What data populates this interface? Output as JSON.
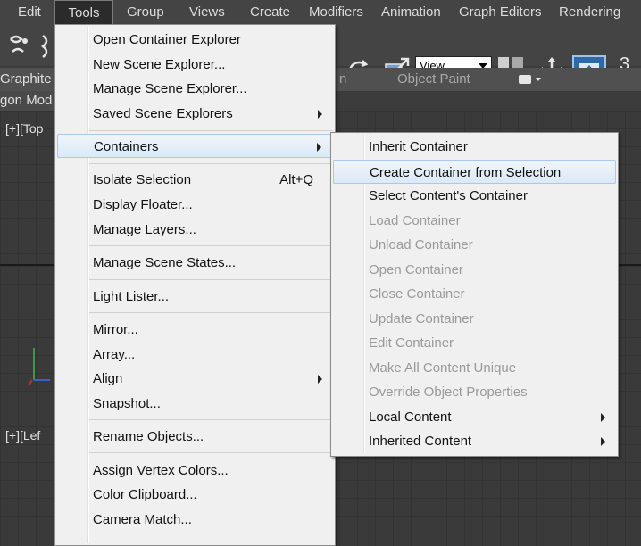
{
  "menubar": {
    "items": [
      {
        "label": "Edit"
      },
      {
        "label": "Tools"
      },
      {
        "label": "Group"
      },
      {
        "label": "Views"
      },
      {
        "label": "Create"
      },
      {
        "label": "Modifiers"
      },
      {
        "label": "Animation"
      },
      {
        "label": "Graph Editors"
      },
      {
        "label": "Rendering"
      }
    ]
  },
  "toolbar": {
    "view_select_value": "View",
    "number_label": "3",
    "icons": [
      "select-link-icon",
      "redo-icon",
      "undo-icon",
      "scale-icon",
      "mirror-icon",
      "move-icon",
      "align-icon"
    ]
  },
  "ribbon": {
    "tab_graphite": "Graphite M",
    "tab_fragment": "n",
    "tab_object_paint": "Object Paint",
    "polygon_label": "gon Mod"
  },
  "viewports": {
    "top_label": "[+][Top",
    "left_label": "[+][Lef"
  },
  "tools_menu": {
    "items": [
      {
        "label": "Open Container Explorer"
      },
      {
        "label": "New Scene Explorer..."
      },
      {
        "label": "Manage Scene Explorer..."
      },
      {
        "label": "Saved Scene Explorers"
      },
      {
        "label": "Containers"
      },
      {
        "label": "Isolate Selection",
        "shortcut": "Alt+Q"
      },
      {
        "label": "Display Floater..."
      },
      {
        "label": "Manage Layers..."
      },
      {
        "label": "Manage Scene States..."
      },
      {
        "label": "Light Lister..."
      },
      {
        "label": "Mirror..."
      },
      {
        "label": "Array..."
      },
      {
        "label": "Align"
      },
      {
        "label": "Snapshot..."
      },
      {
        "label": "Rename Objects..."
      },
      {
        "label": "Assign Vertex Colors..."
      },
      {
        "label": "Color Clipboard..."
      },
      {
        "label": "Camera Match..."
      }
    ]
  },
  "containers_submenu": {
    "items": [
      {
        "label": "Inherit Container"
      },
      {
        "label": "Create Container from Selection"
      },
      {
        "label": "Select Content's Container"
      },
      {
        "label": "Load Container"
      },
      {
        "label": "Unload Container"
      },
      {
        "label": "Open Container"
      },
      {
        "label": "Close Container"
      },
      {
        "label": "Update Container"
      },
      {
        "label": "Edit Container"
      },
      {
        "label": "Make All Content Unique"
      },
      {
        "label": "Override Object Properties"
      },
      {
        "label": "Local Content"
      },
      {
        "label": "Inherited Content"
      }
    ]
  }
}
